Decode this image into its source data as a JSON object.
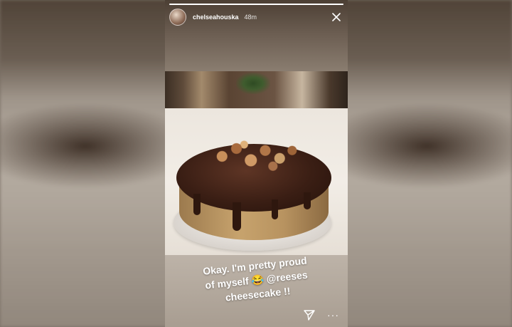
{
  "story": {
    "username": "chelseahouska",
    "time": "48m",
    "progress_fraction": 1.0,
    "caption": {
      "line1": "Okay. I'm pretty proud",
      "line2": "of myself 😂 @reeses",
      "line3": "cheesecake !!"
    },
    "more_label": "···"
  },
  "icons": {
    "close": "close-icon",
    "send": "send-icon",
    "more": "more-icon"
  }
}
